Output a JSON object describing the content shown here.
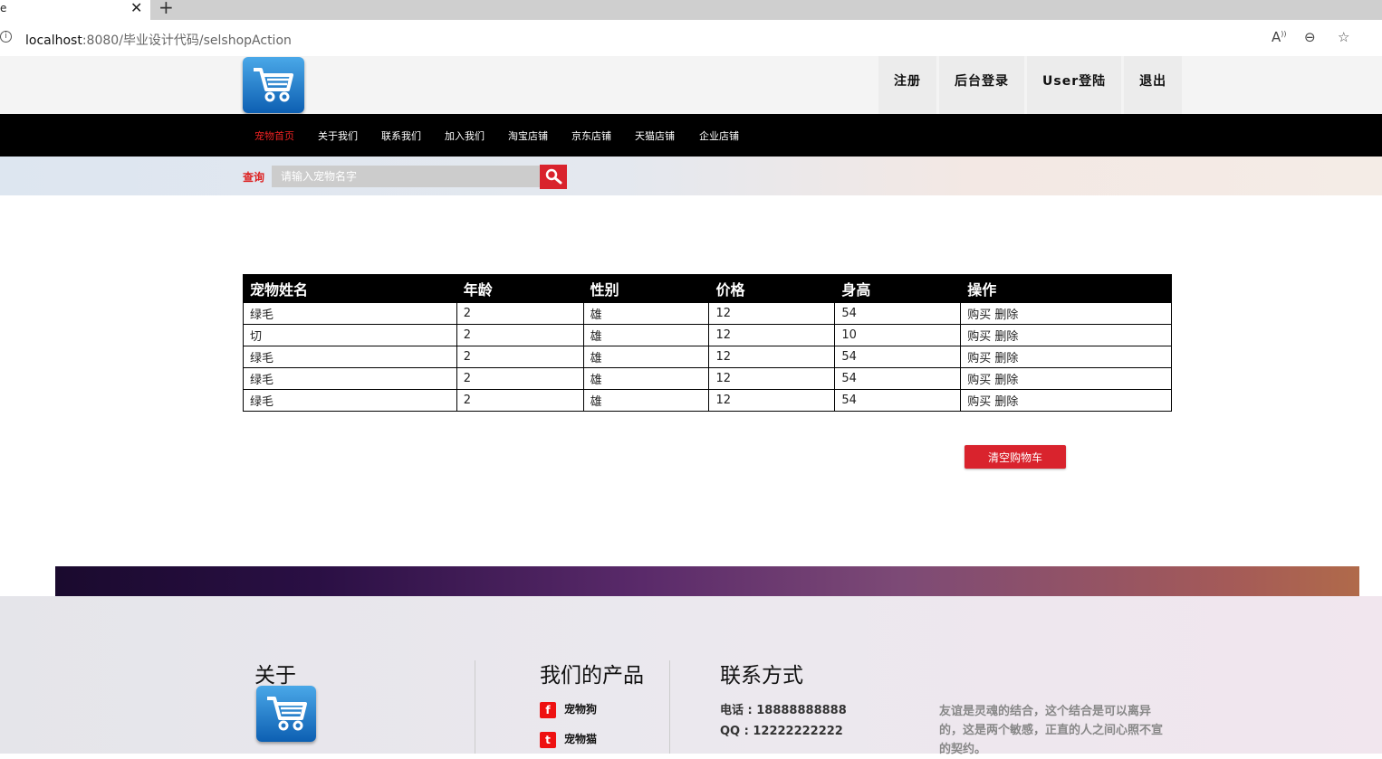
{
  "browser": {
    "tab_title": "e",
    "url_host": "localhost",
    "url_path": ":8080/毕业设计代码/selshopAction"
  },
  "header": {
    "top_links": [
      "注册",
      "后台登录",
      "User登陆",
      "退出"
    ]
  },
  "nav": {
    "items": [
      "宠物首页",
      "关于我们",
      "联系我们",
      "加入我们",
      "淘宝店铺",
      "京东店铺",
      "天猫店铺",
      "企业店铺"
    ]
  },
  "search": {
    "label": "查询",
    "placeholder": "请输入宠物名字"
  },
  "cart": {
    "columns": [
      "宠物姓名",
      "年龄",
      "性别",
      "价格",
      "身高",
      "操作"
    ],
    "rows": [
      {
        "name": "绿毛",
        "age": "2",
        "gender": "雄",
        "price": "12",
        "height": "54",
        "buy": "购买",
        "delete": "删除"
      },
      {
        "name": "切",
        "age": "2",
        "gender": "雄",
        "price": "12",
        "height": "10",
        "buy": "购买",
        "delete": "删除"
      },
      {
        "name": "绿毛",
        "age": "2",
        "gender": "雄",
        "price": "12",
        "height": "54",
        "buy": "购买",
        "delete": "删除"
      },
      {
        "name": "绿毛",
        "age": "2",
        "gender": "雄",
        "price": "12",
        "height": "54",
        "buy": "购买",
        "delete": "删除"
      },
      {
        "name": "绿毛",
        "age": "2",
        "gender": "雄",
        "price": "12",
        "height": "54",
        "buy": "购买",
        "delete": "删除"
      }
    ],
    "clear_label": "清空购物车"
  },
  "footer": {
    "about_title": "关于",
    "products_title": "我们的产品",
    "products": [
      {
        "icon": "facebook-icon",
        "glyph": "f",
        "label": "宠物狗"
      },
      {
        "icon": "twitter-icon",
        "glyph": "t",
        "label": "宠物猫"
      }
    ],
    "contact_title": "联系方式",
    "phone": "电话 : 18888888888",
    "qq": "QQ : 12222222222",
    "quote": "友谊是灵魂的结合，这个结合是可以离异的，这是两个敏感，正直的人之间心照不宣的契约。"
  },
  "colors": {
    "accent_red": "#d9232d",
    "nav_bg": "#000000"
  }
}
